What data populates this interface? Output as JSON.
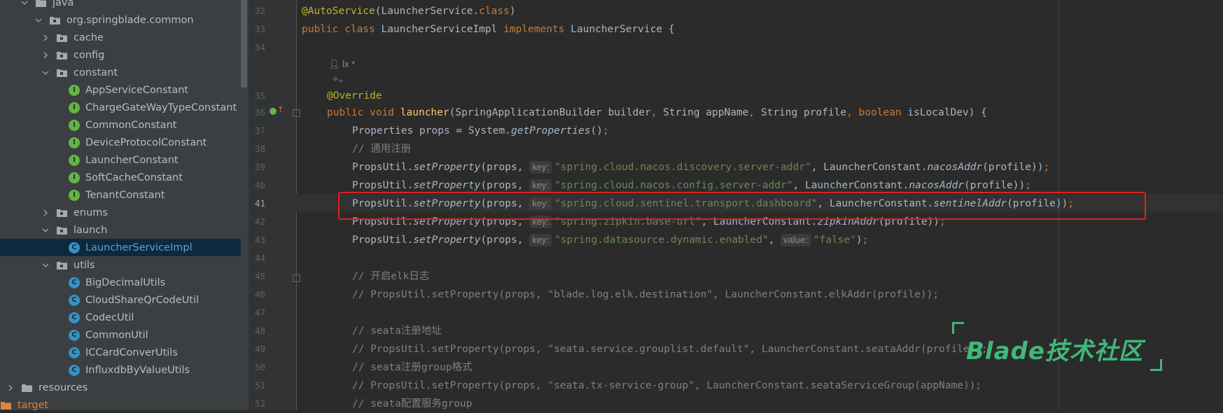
{
  "tree": {
    "items": [
      {
        "label": "java",
        "type": "folder",
        "arrow": "down"
      },
      {
        "label": "org.springblade.common",
        "type": "package",
        "arrow": "down"
      },
      {
        "label": "cache",
        "type": "package",
        "arrow": "right"
      },
      {
        "label": "config",
        "type": "package",
        "arrow": "right"
      },
      {
        "label": "constant",
        "type": "package",
        "arrow": "down"
      },
      {
        "label": "AppServiceConstant",
        "type": "interface"
      },
      {
        "label": "ChargeGateWayTypeConstant",
        "type": "interface"
      },
      {
        "label": "CommonConstant",
        "type": "interface"
      },
      {
        "label": "DeviceProtocolConstant",
        "type": "interface"
      },
      {
        "label": "LauncherConstant",
        "type": "interface"
      },
      {
        "label": "SoftCacheConstant",
        "type": "interface"
      },
      {
        "label": "TenantConstant",
        "type": "interface"
      },
      {
        "label": "enums",
        "type": "package",
        "arrow": "right"
      },
      {
        "label": "launch",
        "type": "package",
        "arrow": "down"
      },
      {
        "label": "LauncherServiceImpl",
        "type": "class",
        "selected": true
      },
      {
        "label": "utils",
        "type": "package",
        "arrow": "down"
      },
      {
        "label": "BigDecimalUtils",
        "type": "class"
      },
      {
        "label": "CloudShareQrCodeUtil",
        "type": "class"
      },
      {
        "label": "CodecUtil",
        "type": "class"
      },
      {
        "label": "CommonUtil",
        "type": "class"
      },
      {
        "label": "ICCardConverUtils",
        "type": "class"
      },
      {
        "label": "InfluxdbByValueUtils",
        "type": "class"
      },
      {
        "label": "resources",
        "type": "resources",
        "arrow": "right"
      },
      {
        "label": "target",
        "type": "target"
      }
    ]
  },
  "editor": {
    "author_hint": "lx *",
    "line_numbers": [
      "32",
      "33",
      "34",
      "35",
      "36",
      "37",
      "38",
      "39",
      "40",
      "41",
      "42",
      "43",
      "44",
      "45",
      "46",
      "47",
      "48",
      "49",
      "50",
      "51",
      "52"
    ],
    "current_line": "41",
    "hint_key": "key:",
    "hint_value": "value:",
    "l32": {
      "a": "@AutoService",
      "b": "(LauncherService.",
      "c": "class",
      "d": ")"
    },
    "l33": {
      "a": "public class ",
      "b": "LauncherServiceImpl ",
      "c": "implements ",
      "d": "LauncherService {"
    },
    "l35": {
      "a": "@Override"
    },
    "l36": {
      "a": "public void ",
      "b": "launcher",
      "c": "(SpringApplicationBuilder builder",
      "d": ", ",
      "e": "String appName",
      "f": ", ",
      "g": "String profile",
      "h": ", ",
      "i": "boolean ",
      "j": "isLocalDev) {"
    },
    "l37": {
      "a": "Properties props = System.",
      "b": "getProperties",
      "c": "()",
      "d": ";"
    },
    "l38": {
      "a": "// 通用注册"
    },
    "l39": {
      "a": "PropsUtil.",
      "b": "setProperty",
      "c": "(props, ",
      "s": "\"spring.cloud.nacos.discovery.server-addr\"",
      "d": ", LauncherConstant.",
      "e": "nacosAddr",
      "f": "(profile))",
      "g": ";"
    },
    "l40": {
      "a": "PropsUtil.",
      "b": "setProperty",
      "c": "(props, ",
      "s": "\"spring.cloud.nacos.config.server-addr\"",
      "d": ", LauncherConstant.",
      "e": "nacosAddr",
      "f": "(profile))",
      "g": ";"
    },
    "l41": {
      "a": "PropsUtil.",
      "b": "setProperty",
      "c": "(props, ",
      "s": "\"spring.cloud.sentinel.transport.dashboard\"",
      "d": ", LauncherConstant.",
      "e": "sentinelAddr",
      "f": "(profile))",
      "g": ";"
    },
    "l42": {
      "a": "PropsUtil.",
      "b": "setProperty",
      "c": "(props, ",
      "s": "\"spring.zipkin.base-url\"",
      "d": ", LauncherConstant.",
      "e": "zipkinAddr",
      "f": "(profile))",
      "g": ";"
    },
    "l43": {
      "a": "PropsUtil.",
      "b": "setProperty",
      "c": "(props, ",
      "s": "\"spring.datasource.dynamic.enabled\"",
      "d": ", ",
      "s2": "\"false\"",
      "e": ")",
      "g": ";"
    },
    "l45": {
      "a": "// 开启elk日志"
    },
    "l46": {
      "a": "// PropsUtil.setProperty(props, \"blade.log.elk.destination\", LauncherConstant.elkAddr(profile));"
    },
    "l48": {
      "a": "// seata注册地址"
    },
    "l49": {
      "a": "// PropsUtil.setProperty(props, \"seata.service.grouplist.default\", LauncherConstant.seataAddr(profile));"
    },
    "l50": {
      "a": "// seata注册group格式"
    },
    "l51": {
      "a": "// PropsUtil.setProperty(props, \"seata.tx-service-group\", LauncherConstant.seataServiceGroup(appName));"
    },
    "l52": {
      "a": "// seata配置服务group"
    }
  },
  "watermark": {
    "text": "Blade技术社区"
  },
  "colors": {
    "keyword": "#cc7832",
    "annotation": "#bbb529",
    "method": "#ffc66d",
    "string": "#6a8759",
    "comment": "#808080",
    "highlight": "#e02020",
    "watermark": "#3fb87a"
  }
}
